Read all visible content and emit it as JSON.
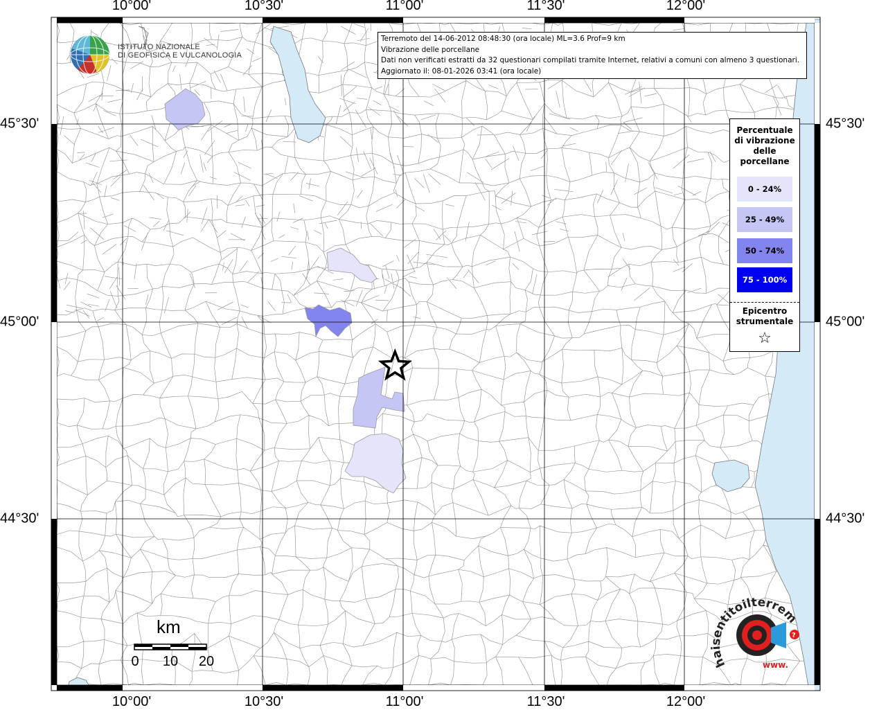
{
  "map": {
    "lon_ticks": [
      "10°00'",
      "10°30'",
      "11°00'",
      "11°30'",
      "12°00'"
    ],
    "lat_ticks": [
      "45°30'",
      "45°00'",
      "44°30'"
    ],
    "extent": {
      "lon": [
        9.75,
        12.333
      ],
      "lat": [
        44.25,
        45.76
      ]
    }
  },
  "info": {
    "line1": "Terremoto del 14-06-2012 08:48:30 (ora locale) ML=3.6 Prof=9 km",
    "line2": "Vibrazione delle porcellane",
    "line3": "Dati non verificati estratti da 32 questionari compilati tramite Internet, relativi a comuni con almeno 3 questionari.",
    "line4": "Aggiornato il: 08-01-2026 03:41 (ora locale)"
  },
  "legend": {
    "title": "Percentuale di vibrazione delle porcellane",
    "classes": [
      {
        "label": "0 - 24%",
        "color": "#e4e4fa",
        "text_color": "#000000"
      },
      {
        "label": "25 - 49%",
        "color": "#c6c6f6",
        "text_color": "#000000"
      },
      {
        "label": "50 - 74%",
        "color": "#8484ef",
        "text_color": "#000000"
      },
      {
        "label": "75 - 100%",
        "color": "#0000f0",
        "text_color": "#ffffff"
      }
    ],
    "epicenter_label": "Epicentro strumentale",
    "epicenter_symbol": "☆"
  },
  "scale_bar": {
    "unit": "km",
    "ticks": [
      "0",
      "10",
      "20"
    ]
  },
  "logos": {
    "ingv_line1": "ISTITUTO NAZIONALE",
    "ingv_line2": "DI GEOFISICA E VULCANOLOGIA",
    "hst_text": "haisentitoilterremoto.it",
    "hst_prefix": "www."
  },
  "colors": {
    "water": "#d4ebf7",
    "boundary": "#9a9a9a",
    "grid": "#000000"
  },
  "epicenter": {
    "lon": 10.97,
    "lat": 44.89
  }
}
